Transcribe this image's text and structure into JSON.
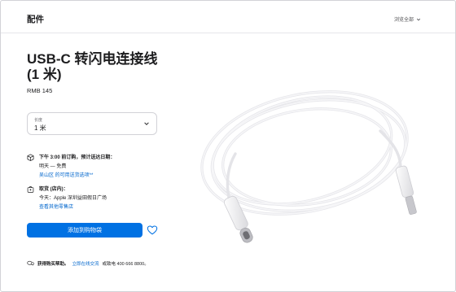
{
  "header": {
    "title": "配件",
    "browse_label": "浏览全部"
  },
  "product": {
    "title_line1": "USB-C 转闪电连接线",
    "title_line2": "(1 米)",
    "price": "RMB 145"
  },
  "length_select": {
    "label": "长度",
    "value": "1 米"
  },
  "delivery": {
    "heading": "下午 3:00 前订购，预计送达日期：",
    "detail": "明天 — 免费",
    "link": "吴山区 的可用送货选项**"
  },
  "pickup": {
    "heading": "取货 (店内)：",
    "detail": "今天：Apple 深圳益田假日广场",
    "link": "查看其他零售店"
  },
  "actions": {
    "add_to_bag": "添加到购物袋"
  },
  "help": {
    "lead": "获得购买帮助。",
    "link": "立即在线交流",
    "phone": "或致电 400 666 8800。"
  },
  "icons": {
    "browse": "chevron-down-icon",
    "select": "chevron-down-icon",
    "delivery": "box-icon",
    "pickup": "store-icon",
    "favorite": "heart-icon",
    "help": "chat-bubbles-icon"
  },
  "colors": {
    "accent": "#0071e3",
    "link": "#0066cc",
    "text": "#1d1d1f"
  }
}
